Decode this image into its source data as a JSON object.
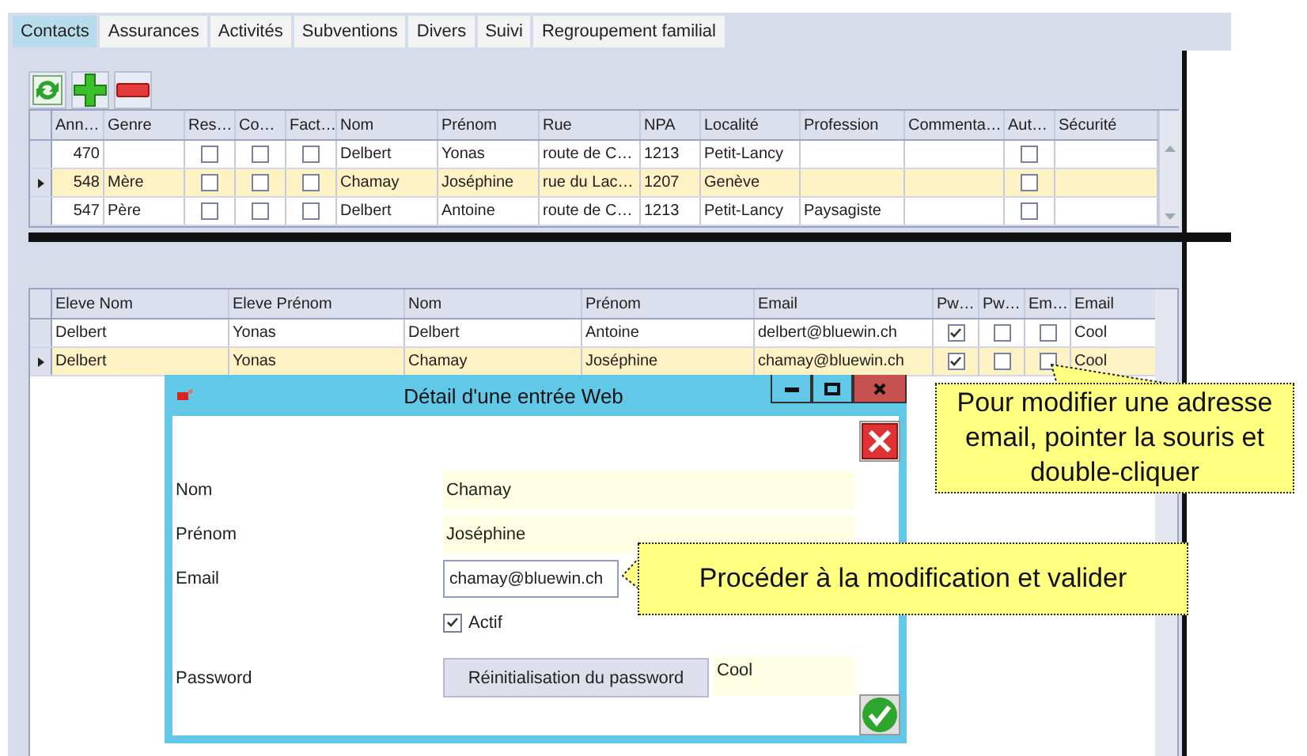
{
  "tabs": [
    {
      "label": "Contacts",
      "selected": true
    },
    {
      "label": "Assurances",
      "selected": false
    },
    {
      "label": "Activités",
      "selected": false
    },
    {
      "label": "Subventions",
      "selected": false
    },
    {
      "label": "Divers",
      "selected": false
    },
    {
      "label": "Suivi",
      "selected": false
    },
    {
      "label": "Regroupement familial",
      "selected": false
    }
  ],
  "contacts_table": {
    "columns": [
      {
        "label": "Ann…",
        "kind": "number"
      },
      {
        "label": "Genre",
        "kind": "text"
      },
      {
        "label": "Res…",
        "kind": "check"
      },
      {
        "label": "Co…",
        "kind": "check"
      },
      {
        "label": "Fact…",
        "kind": "check"
      },
      {
        "label": "Nom",
        "kind": "text"
      },
      {
        "label": "Prénom",
        "kind": "text"
      },
      {
        "label": "Rue",
        "kind": "text"
      },
      {
        "label": "NPA",
        "kind": "text"
      },
      {
        "label": "Localité",
        "kind": "text"
      },
      {
        "label": "Profession",
        "kind": "text"
      },
      {
        "label": "Commenta…",
        "kind": "text"
      },
      {
        "label": "Aut…",
        "kind": "check"
      },
      {
        "label": "Sécurité",
        "kind": "text"
      }
    ],
    "rows": [
      {
        "selected": false,
        "cells": [
          "470",
          null,
          {
            "checked": false
          },
          {
            "checked": false
          },
          {
            "checked": false
          },
          "Delbert",
          "Yonas",
          "route de C…",
          "1213",
          "Petit-Lancy",
          null,
          null,
          {
            "checked": false
          },
          null
        ]
      },
      {
        "selected": true,
        "cells": [
          "548",
          "Mère",
          {
            "checked": false
          },
          {
            "checked": false
          },
          {
            "checked": false
          },
          "Chamay",
          "Joséphine",
          "rue du Lac…",
          "1207",
          "Genève",
          null,
          null,
          {
            "checked": false
          },
          null
        ]
      },
      {
        "selected": false,
        "cells": [
          "547",
          "Père",
          {
            "checked": false
          },
          {
            "checked": false
          },
          {
            "checked": false
          },
          "Delbert",
          "Antoine",
          "route de C…",
          "1213",
          "Petit-Lancy",
          "Paysagiste",
          null,
          {
            "checked": false
          },
          null
        ]
      }
    ]
  },
  "web_table": {
    "columns": [
      {
        "label": "Eleve Nom",
        "kind": "text"
      },
      {
        "label": "Eleve Prénom",
        "kind": "text"
      },
      {
        "label": "Nom",
        "kind": "text"
      },
      {
        "label": "Prénom",
        "kind": "text"
      },
      {
        "label": "Email",
        "kind": "text"
      },
      {
        "label": "Pw…",
        "kind": "check"
      },
      {
        "label": "Pw…",
        "kind": "check"
      },
      {
        "label": "Em…",
        "kind": "check"
      },
      {
        "label": "Email",
        "kind": "text"
      }
    ],
    "rows": [
      {
        "selected": false,
        "cells": [
          "Delbert",
          "Yonas",
          "Delbert",
          "Antoine",
          "delbert@bluewin.ch",
          {
            "checked": true
          },
          {
            "checked": false
          },
          {
            "checked": false
          },
          "Cool"
        ]
      },
      {
        "selected": true,
        "cells": [
          "Delbert",
          "Yonas",
          "Chamay",
          "Joséphine",
          "chamay@bluewin.ch",
          {
            "checked": true
          },
          {
            "checked": false
          },
          {
            "checked": false
          },
          "Cool"
        ]
      }
    ]
  },
  "dialog": {
    "title": "Détail d'une entrée Web",
    "fields": [
      {
        "kind": "readonly",
        "label": "Nom",
        "value": "Chamay"
      },
      {
        "kind": "readonly",
        "label": "Prénom",
        "value": "Joséphine"
      },
      {
        "kind": "input",
        "label": "Email",
        "value": "chamay@bluewin.ch"
      },
      {
        "kind": "checkbox",
        "label": "Actif",
        "checked": true
      },
      {
        "kind": "button",
        "label": "Password",
        "button": "Réinitialisation du password",
        "value": "Cool"
      }
    ]
  },
  "callouts": [
    {
      "text": "Pour modifier une adresse email, pointer la souris et double-cliquer"
    },
    {
      "text": "Procéder à la modification et valider"
    }
  ]
}
